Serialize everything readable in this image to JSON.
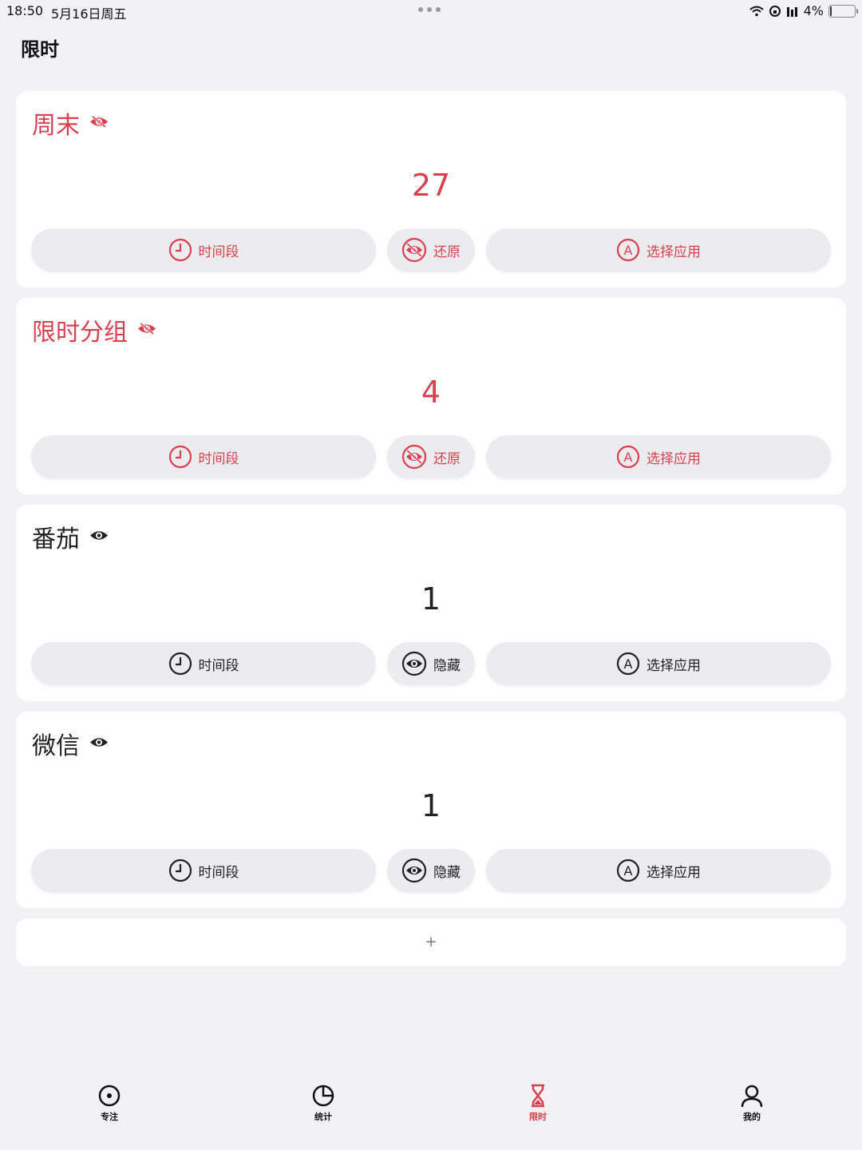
{
  "status_bar": {
    "time": "18:50",
    "date": "5月16日周五",
    "battery": "4%",
    "battery_level": 0.04
  },
  "page": {
    "title": "限时"
  },
  "groups": [
    {
      "title": "周末",
      "count": "27",
      "active": true,
      "time_label": "时间段",
      "toggle_label": "还原",
      "apps_label": "选择应用",
      "icon": "eye-slash-icon"
    },
    {
      "title": "限时分组",
      "count": "4",
      "active": true,
      "time_label": "时间段",
      "toggle_label": "还原",
      "apps_label": "选择应用",
      "icon": "eye-slash-icon"
    },
    {
      "title": "番茄",
      "count": "1",
      "active": false,
      "time_label": "时间段",
      "toggle_label": "隐藏",
      "apps_label": "选择应用",
      "icon": "eye-icon"
    },
    {
      "title": "微信",
      "count": "1",
      "active": false,
      "time_label": "时间段",
      "toggle_label": "隐藏",
      "apps_label": "选择应用",
      "icon": "eye-icon"
    }
  ],
  "add_button": {
    "label": "+"
  },
  "tabs": [
    {
      "label": "专注",
      "icon": "focus-icon",
      "active": false
    },
    {
      "label": "统计",
      "icon": "pie-chart-icon",
      "active": false
    },
    {
      "label": "限时",
      "icon": "hourglass-icon",
      "active": true
    },
    {
      "label": "我的",
      "icon": "person-icon",
      "active": false
    }
  ],
  "colors": {
    "accent": "#d9404f",
    "text": "#222222",
    "background": "#f2f2f4",
    "card": "#ffffff",
    "button": "#ececee"
  }
}
